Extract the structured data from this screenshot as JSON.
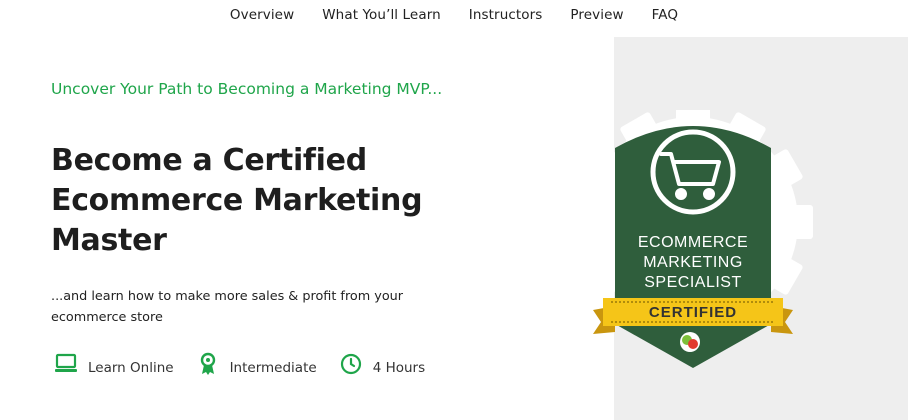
{
  "nav": {
    "items": [
      {
        "label": "Overview"
      },
      {
        "label": "What You’ll Learn"
      },
      {
        "label": "Instructors"
      },
      {
        "label": "Preview"
      },
      {
        "label": "FAQ"
      }
    ]
  },
  "hero": {
    "eyebrow": "Uncover Your Path to Becoming a Marketing MVP...",
    "headline_line1": "Become a Certified",
    "headline_line2": "Ecommerce Marketing",
    "headline_line3": "Master",
    "subline_line1": "...and learn how to make more sales & profit from your",
    "subline_line2": "ecommerce store",
    "features": [
      {
        "icon": "laptop-icon",
        "label": "Learn Online"
      },
      {
        "icon": "award-ribbon-icon",
        "label": "Intermediate"
      },
      {
        "icon": "clock-icon",
        "label": "4 Hours"
      }
    ]
  },
  "badge": {
    "line1": "ECOMMERCE",
    "line2": "MARKETING",
    "line3": "SPECIALIST",
    "ribbon": "CERTIFIED"
  },
  "colors": {
    "accent_green": "#1fa54a",
    "badge_green": "#2f5e3c",
    "ribbon_gold": "#f5c518"
  }
}
